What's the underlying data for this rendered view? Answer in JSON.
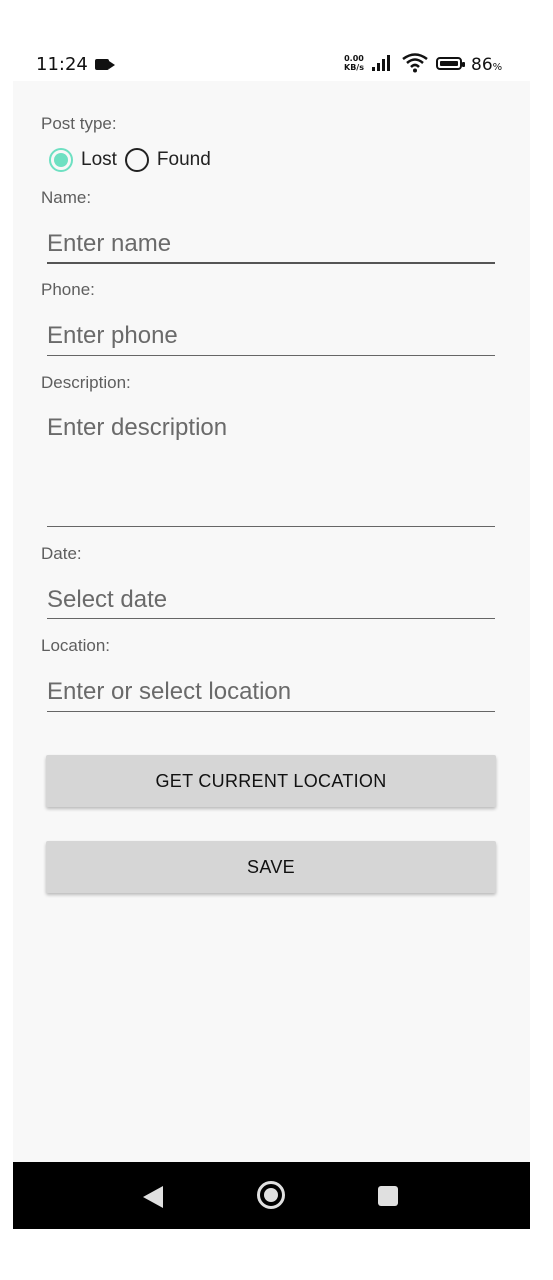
{
  "status_bar": {
    "time": "11:24",
    "net_speed_value": "0.00",
    "net_speed_unit": "KB/s",
    "battery": "86",
    "battery_unit": "%"
  },
  "form": {
    "post_type_label": "Post type:",
    "post_type_options": [
      {
        "label": "Lost",
        "selected": true
      },
      {
        "label": "Found",
        "selected": false
      }
    ],
    "name_label": "Name:",
    "name_placeholder": "Enter name",
    "phone_label": "Phone:",
    "phone_placeholder": "Enter phone",
    "description_label": "Description:",
    "description_placeholder": "Enter description",
    "date_label": "Date:",
    "date_placeholder": "Select date",
    "location_label": "Location:",
    "location_placeholder": "Enter or select location",
    "get_location_button": "GET CURRENT LOCATION",
    "save_button": "SAVE"
  },
  "colors": {
    "accent": "#6ee0c2",
    "background": "#f8f8f8",
    "button": "#d6d6d6",
    "nav_bar": "#000000"
  },
  "icons": {
    "status": [
      "camera-icon",
      "signal-icon",
      "wifi-icon",
      "battery-icon"
    ],
    "nav": [
      "back-icon",
      "home-icon",
      "recents-icon"
    ]
  }
}
